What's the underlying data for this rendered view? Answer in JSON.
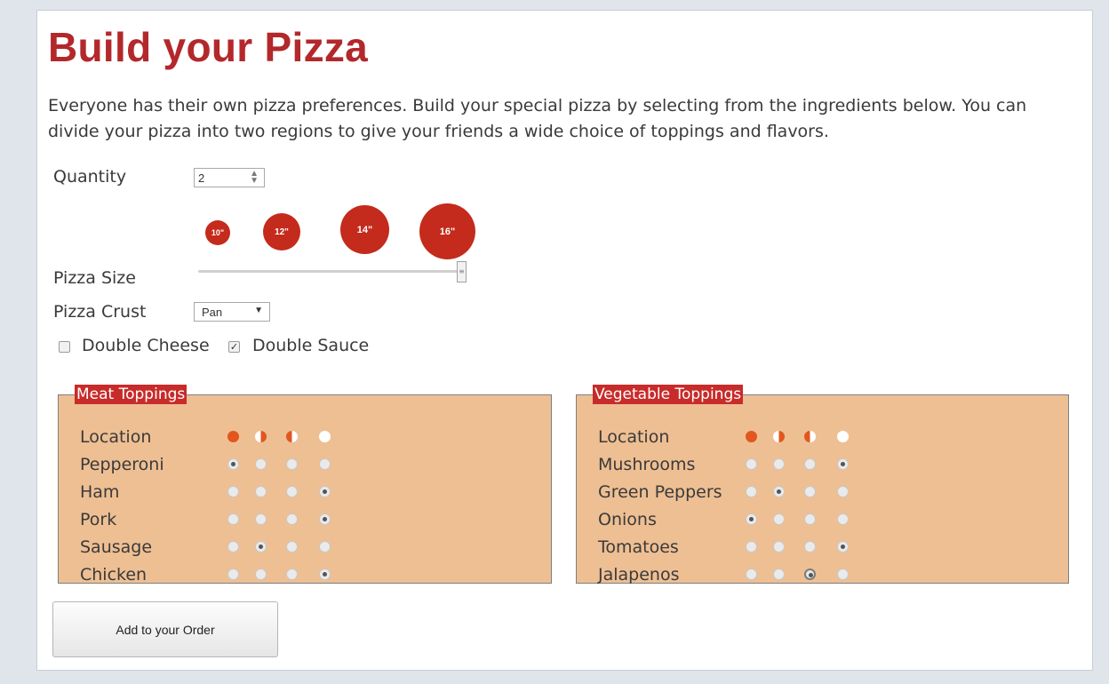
{
  "title": "Build your Pizza",
  "intro": "Everyone has their own pizza preferences. Build your special pizza by selecting from the ingredients below. You can divide your pizza into two regions to give your friends a wide choice of toppings and flavors.",
  "quantity": {
    "label": "Quantity",
    "value": "2"
  },
  "size": {
    "label": "Pizza Size",
    "options": [
      "10\"",
      "12\"",
      "14\"",
      "16\""
    ],
    "selected": "16\""
  },
  "crust": {
    "label": "Pizza Crust",
    "value": "Pan"
  },
  "options": {
    "double_cheese": {
      "label": "Double Cheese",
      "checked": false
    },
    "double_sauce": {
      "label": "Double Sauce",
      "checked": true
    }
  },
  "meat": {
    "legend": "Meat Toppings",
    "location_label": "Location",
    "items": [
      {
        "name": "Pepperoni",
        "selected": 0
      },
      {
        "name": "Ham",
        "selected": 3
      },
      {
        "name": "Pork",
        "selected": 3
      },
      {
        "name": "Sausage",
        "selected": 1
      },
      {
        "name": "Chicken",
        "selected": 3
      }
    ]
  },
  "veg": {
    "legend": "Vegetable Toppings",
    "location_label": "Location",
    "items": [
      {
        "name": "Mushrooms",
        "selected": 3
      },
      {
        "name": "Green Peppers",
        "selected": 1
      },
      {
        "name": "Onions",
        "selected": 0
      },
      {
        "name": "Tomatoes",
        "selected": 3
      },
      {
        "name": "Jalapenos",
        "selected": 2
      }
    ]
  },
  "location_icons": [
    "whole-pizza-icon",
    "left-half-icon",
    "right-half-icon",
    "no-pizza-icon"
  ],
  "colors": {
    "title": "#b3282b",
    "accent": "#c42b1c",
    "panel": "#eebf93",
    "legend": "#c72c2a"
  },
  "add_button": "Add to your Order"
}
